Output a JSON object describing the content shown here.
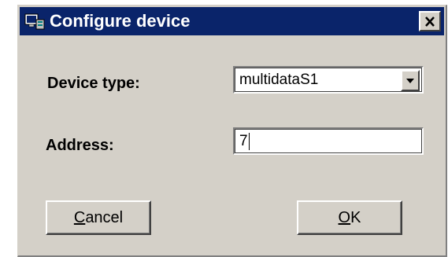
{
  "window": {
    "title": "Configure device",
    "icon": "device-config-icon",
    "close_label": "×"
  },
  "form": {
    "device_type_label": "Device type:",
    "device_type_value": "multidataS1",
    "address_label": "Address:",
    "address_value": "7"
  },
  "buttons": {
    "cancel_accel": "C",
    "cancel_rest": "ancel",
    "ok_accel": "O",
    "ok_rest": "K"
  },
  "colors": {
    "titlebar": "#0a246a",
    "face": "#d4d0c8"
  }
}
